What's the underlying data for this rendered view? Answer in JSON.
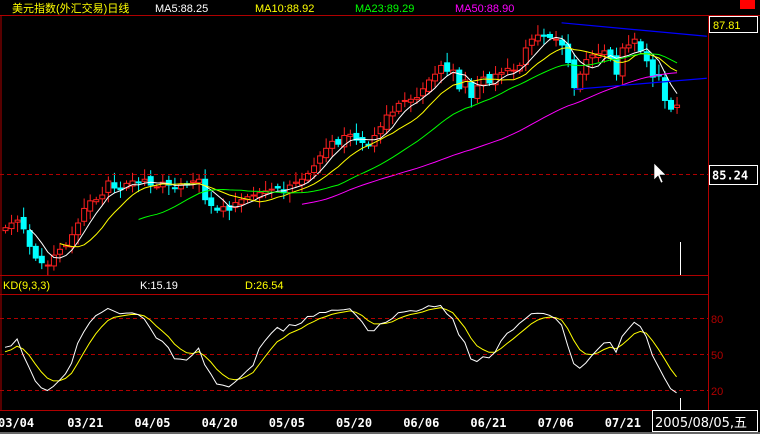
{
  "header": {
    "title": "美元指数(外汇交易)日线",
    "ma_labels": [
      {
        "text": "MA5:88.25",
        "color": "#ffffff"
      },
      {
        "text": "MA10:88.92",
        "color": "#ffff00"
      },
      {
        "text": "MA23:89.29",
        "color": "#00ff00"
      },
      {
        "text": "MA50:88.90",
        "color": "#ff00ff"
      }
    ]
  },
  "price_axis": {
    "top_label": "87.81",
    "ref_label": "85.24",
    "top_value": 87.81,
    "ref_value": 85.24
  },
  "kd_panel": {
    "title": "KD(9,3,3)",
    "k_label": "K:15.19",
    "d_label": "D:26.54",
    "levels": [
      "80",
      "50",
      "20"
    ]
  },
  "date_axis": {
    "labels": [
      "03/04",
      "03/21",
      "04/05",
      "04/20",
      "05/05",
      "05/20",
      "06/06",
      "06/21",
      "07/06",
      "07/21"
    ],
    "current_date": "2005/08/05,五"
  },
  "colors": {
    "up": "#ff2020",
    "down": "#00ffff",
    "ma5": "#ffffff",
    "ma10": "#ffff00",
    "ma23": "#00ff00",
    "ma50": "#ff00ff",
    "k": "#ffffff",
    "d": "#ffff00",
    "border": "#b00000",
    "trend": "#0000ff"
  },
  "chart_data": {
    "type": "candlestick",
    "title": "美元指数(外汇交易)日线",
    "ylim": [
      83.55,
      88.1
    ],
    "ma_periods": [
      5,
      10,
      23,
      50
    ],
    "kd_params": [
      9,
      3,
      3
    ],
    "closes": [
      84.32,
      84.4,
      84.45,
      84.3,
      84.0,
      83.8,
      83.72,
      83.68,
      83.85,
      83.95,
      84.02,
      84.2,
      84.4,
      84.65,
      84.78,
      84.8,
      84.88,
      85.12,
      85.0,
      84.97,
      85.08,
      85.12,
      85.1,
      85.15,
      85.05,
      85.02,
      85.1,
      85.05,
      85.0,
      85.06,
      85.05,
      85.12,
      85.15,
      84.8,
      84.7,
      84.62,
      84.68,
      84.62,
      84.75,
      84.8,
      84.85,
      84.88,
      84.92,
      84.95,
      84.98,
      85.0,
      84.92,
      85.05,
      85.1,
      85.15,
      85.25,
      85.38,
      85.55,
      85.68,
      85.8,
      85.75,
      85.9,
      85.92,
      85.82,
      85.78,
      85.72,
      85.9,
      86.05,
      86.25,
      86.3,
      86.45,
      86.5,
      86.52,
      86.55,
      86.7,
      86.85,
      86.95,
      87.1,
      87.0,
      87.02,
      86.7,
      86.85,
      86.55,
      86.75,
      86.9,
      86.8,
      86.95,
      86.98,
      87.05,
      87.02,
      87.1,
      87.4,
      87.55,
      87.62,
      87.6,
      87.58,
      87.55,
      87.45,
      87.15,
      86.72,
      86.95,
      87.2,
      87.28,
      87.3,
      87.35,
      87.22,
      86.95,
      87.4,
      87.45,
      87.55,
      87.35,
      87.18,
      86.9,
      86.92,
      86.5,
      86.35,
      86.42
    ],
    "trendlines": [
      {
        "from_index": 92,
        "from_price": 87.83,
        "to_index": 116,
        "to_price": 87.6
      },
      {
        "from_index": 94,
        "from_price": 86.69,
        "to_index": 116,
        "to_price": 86.88
      }
    ]
  }
}
